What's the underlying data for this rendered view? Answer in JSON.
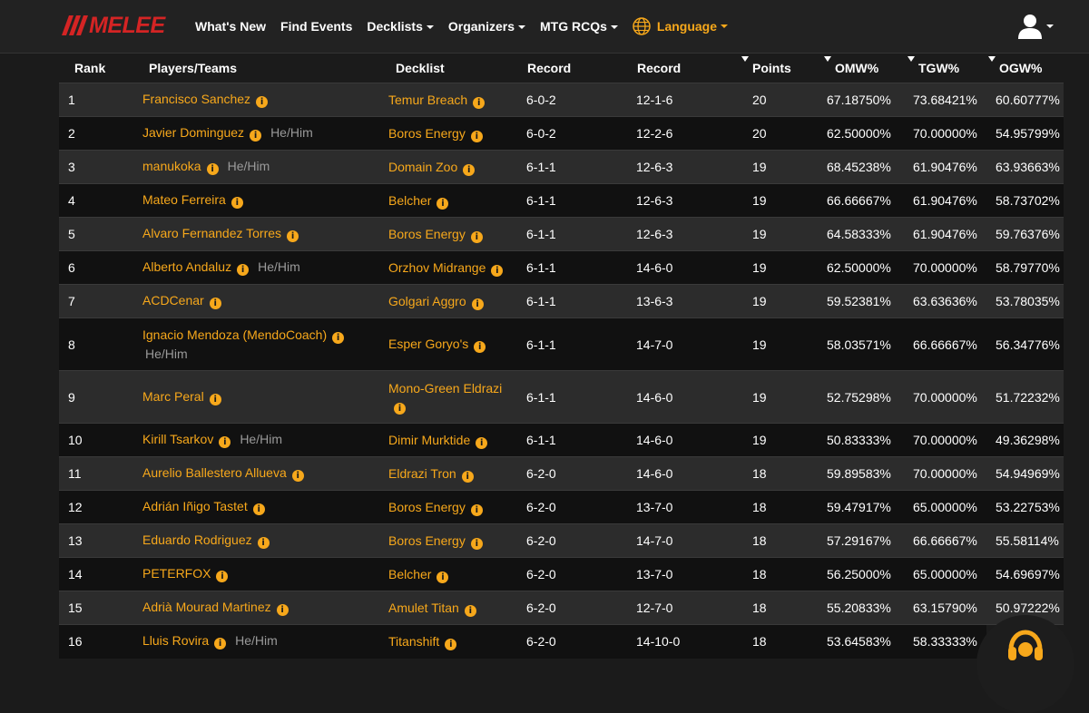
{
  "nav": {
    "logo": "MELEE",
    "items": [
      {
        "label": "What's New",
        "dropdown": false
      },
      {
        "label": "Find Events",
        "dropdown": false
      },
      {
        "label": "Decklists",
        "dropdown": true
      },
      {
        "label": "Organizers",
        "dropdown": true
      },
      {
        "label": "MTG RCQs",
        "dropdown": true
      }
    ],
    "language": "Language"
  },
  "colors": {
    "accent": "#f7a81b",
    "brand": "#d42424",
    "row_odd": "#2c2c2c",
    "row_even": "#111111"
  },
  "table": {
    "headers": [
      "Rank",
      "Players/Teams",
      "Decklist",
      "Record",
      "Record",
      "Points",
      "OMW%",
      "TGW%",
      "OGW%"
    ],
    "rows": [
      {
        "rank": "1",
        "player": "Francisco Sanchez",
        "pronoun": "",
        "deck": "Temur Breach",
        "record": "6-0-2",
        "game_record": "12-1-6",
        "points": "20",
        "omw": "67.18750%",
        "tgw": "73.68421%",
        "ogw": "60.60777%"
      },
      {
        "rank": "2",
        "player": "Javier Dominguez",
        "pronoun": "He/Him",
        "deck": "Boros Energy",
        "record": "6-0-2",
        "game_record": "12-2-6",
        "points": "20",
        "omw": "62.50000%",
        "tgw": "70.00000%",
        "ogw": "54.95799%"
      },
      {
        "rank": "3",
        "player": "manukoka",
        "pronoun": "He/Him",
        "deck": "Domain Zoo",
        "record": "6-1-1",
        "game_record": "12-6-3",
        "points": "19",
        "omw": "68.45238%",
        "tgw": "61.90476%",
        "ogw": "63.93663%"
      },
      {
        "rank": "4",
        "player": "Mateo Ferreira",
        "pronoun": "",
        "deck": "Belcher",
        "record": "6-1-1",
        "game_record": "12-6-3",
        "points": "19",
        "omw": "66.66667%",
        "tgw": "61.90476%",
        "ogw": "58.73702%"
      },
      {
        "rank": "5",
        "player": "Alvaro Fernandez Torres",
        "pronoun": "",
        "deck": "Boros Energy",
        "record": "6-1-1",
        "game_record": "12-6-3",
        "points": "19",
        "omw": "64.58333%",
        "tgw": "61.90476%",
        "ogw": "59.76376%"
      },
      {
        "rank": "6",
        "player": "Alberto Andaluz",
        "pronoun": "He/Him",
        "deck": "Orzhov Midrange",
        "record": "6-1-1",
        "game_record": "14-6-0",
        "points": "19",
        "omw": "62.50000%",
        "tgw": "70.00000%",
        "ogw": "58.79770%"
      },
      {
        "rank": "7",
        "player": "ACDCenar",
        "pronoun": "",
        "deck": "Golgari Aggro",
        "record": "6-1-1",
        "game_record": "13-6-3",
        "points": "19",
        "omw": "59.52381%",
        "tgw": "63.63636%",
        "ogw": "53.78035%"
      },
      {
        "rank": "8",
        "player": "Ignacio Mendoza (MendoCoach)",
        "pronoun": "He/Him",
        "deck": "Esper Goryo's",
        "record": "6-1-1",
        "game_record": "14-7-0",
        "points": "19",
        "omw": "58.03571%",
        "tgw": "66.66667%",
        "ogw": "56.34776%"
      },
      {
        "rank": "9",
        "player": "Marc Peral",
        "pronoun": "",
        "deck": "Mono-Green Eldrazi",
        "record": "6-1-1",
        "game_record": "14-6-0",
        "points": "19",
        "omw": "52.75298%",
        "tgw": "70.00000%",
        "ogw": "51.72232%"
      },
      {
        "rank": "10",
        "player": "Kirill Tsarkov",
        "pronoun": "He/Him",
        "deck": "Dimir Murktide",
        "record": "6-1-1",
        "game_record": "14-6-0",
        "points": "19",
        "omw": "50.83333%",
        "tgw": "70.00000%",
        "ogw": "49.36298%"
      },
      {
        "rank": "11",
        "player": "Aurelio Ballestero Allueva",
        "pronoun": "",
        "deck": "Eldrazi Tron",
        "record": "6-2-0",
        "game_record": "14-6-0",
        "points": "18",
        "omw": "59.89583%",
        "tgw": "70.00000%",
        "ogw": "54.94969%"
      },
      {
        "rank": "12",
        "player": "Adrián Iñigo Tastet",
        "pronoun": "",
        "deck": "Boros Energy",
        "record": "6-2-0",
        "game_record": "13-7-0",
        "points": "18",
        "omw": "59.47917%",
        "tgw": "65.00000%",
        "ogw": "53.22753%"
      },
      {
        "rank": "13",
        "player": "Eduardo Rodriguez",
        "pronoun": "",
        "deck": "Boros Energy",
        "record": "6-2-0",
        "game_record": "14-7-0",
        "points": "18",
        "omw": "57.29167%",
        "tgw": "66.66667%",
        "ogw": "55.58114%"
      },
      {
        "rank": "14",
        "player": "PETERFOX",
        "pronoun": "",
        "deck": "Belcher",
        "record": "6-2-0",
        "game_record": "13-7-0",
        "points": "18",
        "omw": "56.25000%",
        "tgw": "65.00000%",
        "ogw": "54.69697%"
      },
      {
        "rank": "15",
        "player": "Adrià Mourad Martinez",
        "pronoun": "",
        "deck": "Amulet Titan",
        "record": "6-2-0",
        "game_record": "12-7-0",
        "points": "18",
        "omw": "55.20833%",
        "tgw": "63.15790%",
        "ogw": "50.97222%"
      },
      {
        "rank": "16",
        "player": "Lluis Rovira",
        "pronoun": "He/Him",
        "deck": "Titanshift",
        "record": "6-2-0",
        "game_record": "14-10-0",
        "points": "18",
        "omw": "53.64583%",
        "tgw": "58.33333%",
        "ogw": ""
      }
    ]
  }
}
